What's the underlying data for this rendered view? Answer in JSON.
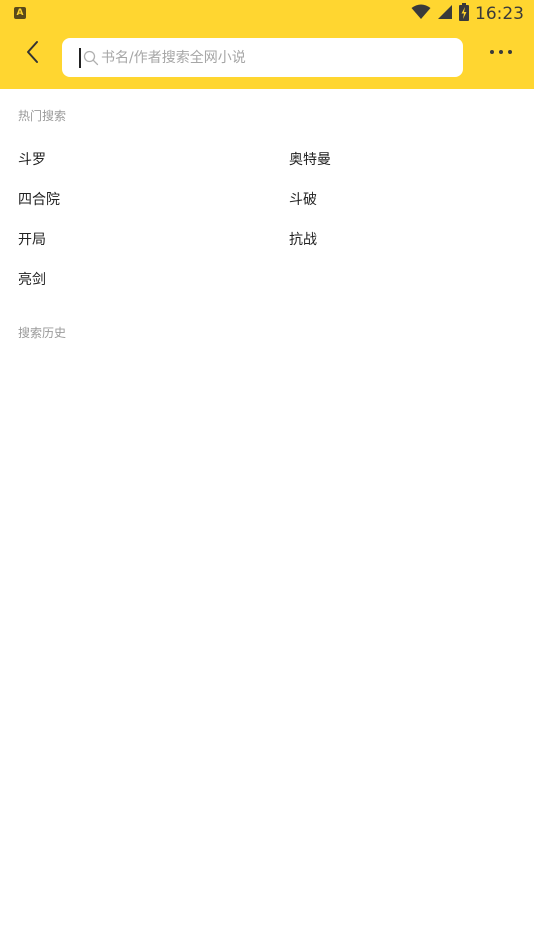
{
  "status_bar": {
    "time": "16:23",
    "app_indicator_icon": "a-letter-icon",
    "icons": [
      "wifi-icon",
      "cell-signal-icon",
      "battery-charging-icon"
    ]
  },
  "toolbar": {
    "back_icon": "chevron-left-icon",
    "more_icon": "more-horizontal-icon",
    "background_color": "#FFD630"
  },
  "search": {
    "placeholder": "书名/作者搜索全网小说",
    "value": "",
    "icon": "search-icon"
  },
  "hot_search": {
    "title": "热门搜索",
    "items": [
      "斗罗",
      "奥特曼",
      "四合院",
      "斗破",
      "开局",
      "抗战",
      "亮剑"
    ]
  },
  "history": {
    "title": "搜索历史",
    "items": []
  }
}
